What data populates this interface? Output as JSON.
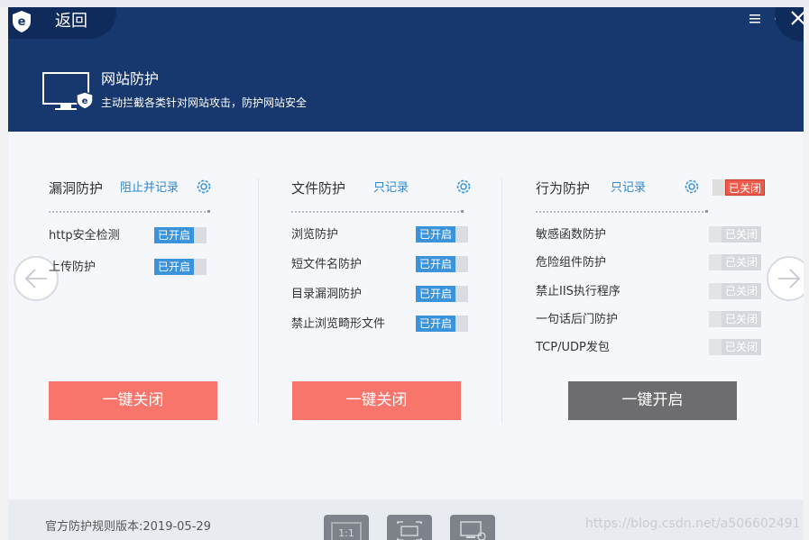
{
  "window": {
    "back_label": "返回",
    "colors": {
      "header": "#17386e",
      "accent_blue": "#3b93dc",
      "danger_red": "#f7756a",
      "neutral_gray": "#6d6d6f"
    }
  },
  "header": {
    "title": "网站防护",
    "subtitle": "主动拦截各类针对网站攻击，防护网站安全",
    "icons": [
      "logo-icon",
      "menu-icon",
      "minimize-icon",
      "close-icon",
      "monitor-shield-icon"
    ]
  },
  "columns": [
    {
      "title": "漏洞防护",
      "mode": "阻止并记录",
      "items": [
        {
          "label": "http安全检测",
          "state": "已开启",
          "on": true
        },
        {
          "label": "上传防护",
          "state": "已开启",
          "on": true
        }
      ],
      "action": "一键关闭"
    },
    {
      "title": "文件防护",
      "mode": "只记录",
      "items": [
        {
          "label": "浏览防护",
          "state": "已开启",
          "on": true
        },
        {
          "label": "短文件名防护",
          "state": "已开启",
          "on": true
        },
        {
          "label": "目录漏洞防护",
          "state": "已开启",
          "on": true
        },
        {
          "label": "禁止浏览畸形文件",
          "state": "已开启",
          "on": true
        }
      ],
      "action": "一键关闭"
    },
    {
      "title": "行为防护",
      "mode": "只记录",
      "master_state": "已关闭",
      "items": [
        {
          "label": "敏感函数防护",
          "state": "已关闭",
          "on": false
        },
        {
          "label": "危险组件防护",
          "state": "已关闭",
          "on": false
        },
        {
          "label": "禁止IIS执行程序",
          "state": "已关闭",
          "on": false
        },
        {
          "label": "一句话后门防护",
          "state": "已关闭",
          "on": false
        },
        {
          "label": "TCP/UDP发包",
          "state": "已关闭",
          "on": false
        }
      ],
      "action": "一键开启"
    }
  ],
  "footer": {
    "rule_version": "官方防护规则版本:2019-05-29",
    "watermark": "https://blog.csdn.net/a506602491"
  }
}
